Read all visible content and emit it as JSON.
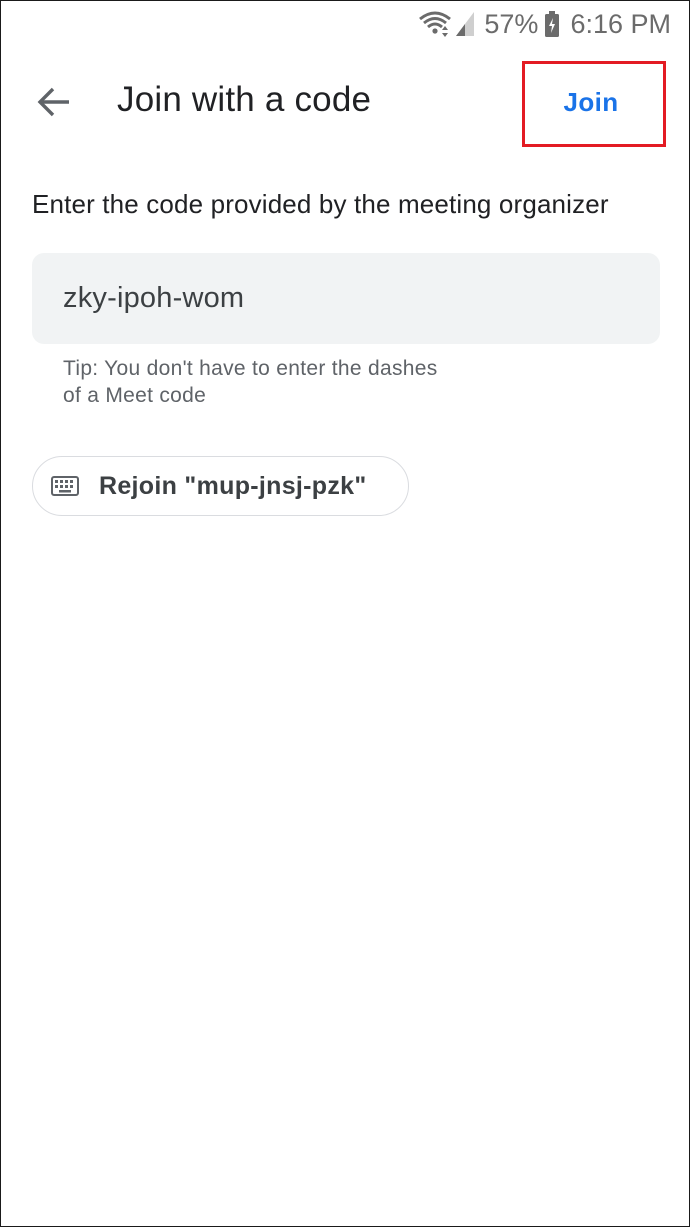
{
  "status_bar": {
    "battery_percent": "57%",
    "time": "6:16 PM",
    "icons": [
      "wifi-icon",
      "signal-icon",
      "battery-icon"
    ]
  },
  "app_bar": {
    "back_icon": "arrow-back-icon",
    "title": "Join with a code",
    "join_label": "Join"
  },
  "content": {
    "instructions": "Enter the code provided by the meeting organizer",
    "code_input": {
      "value": "zky-ipoh-wom",
      "placeholder": ""
    },
    "tip_line1": "Tip: You don't have to enter the dashes",
    "tip_line2": "of a Meet code",
    "rejoin": {
      "icon": "keyboard-icon",
      "label": "Rejoin \"mup-jnsj-pzk\""
    }
  },
  "colors": {
    "accent": "#1a73e8",
    "highlight_box": "#e31b23",
    "field_background": "#f1f3f4",
    "text_primary": "#202124",
    "text_secondary": "#5f6368"
  }
}
